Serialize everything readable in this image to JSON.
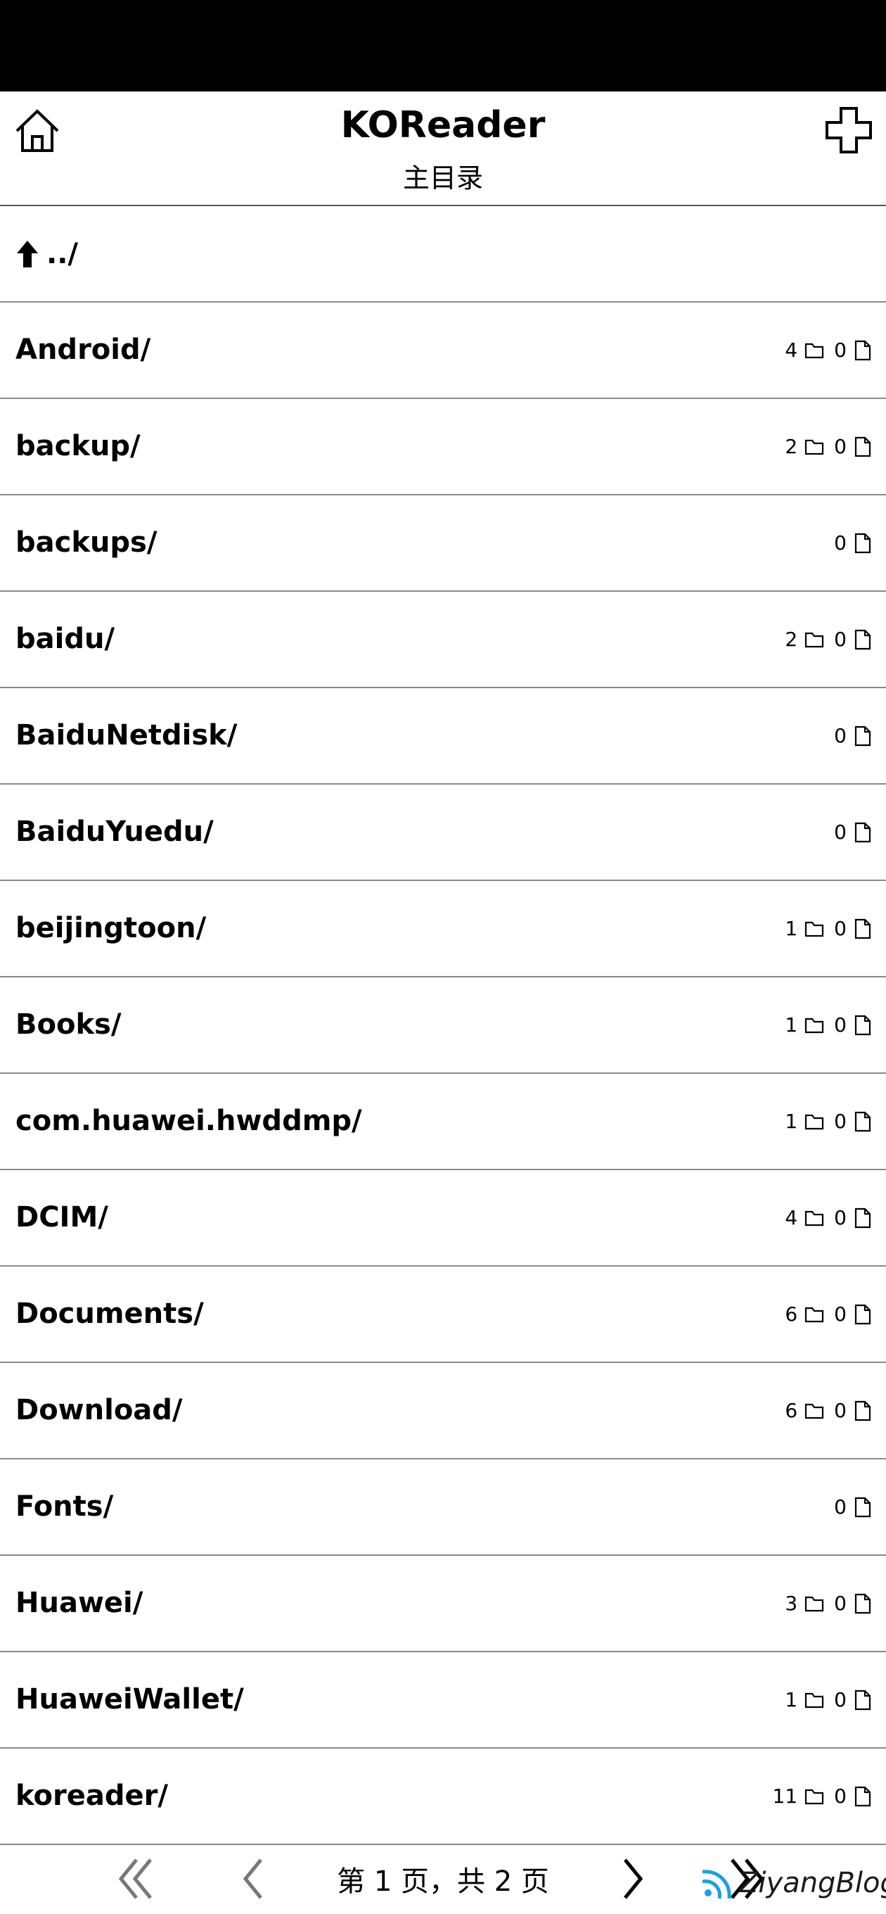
{
  "header": {
    "title": "KOReader",
    "subtitle": "主目录"
  },
  "up_item": {
    "label": "../"
  },
  "items": [
    {
      "name": "Android/",
      "folders": "4",
      "files": "0"
    },
    {
      "name": "backup/",
      "folders": "2",
      "files": "0"
    },
    {
      "name": "backups/",
      "folders": "",
      "files": "0"
    },
    {
      "name": "baidu/",
      "folders": "2",
      "files": "0"
    },
    {
      "name": "BaiduNetdisk/",
      "folders": "",
      "files": "0"
    },
    {
      "name": "BaiduYuedu/",
      "folders": "",
      "files": "0"
    },
    {
      "name": "beijingtoon/",
      "folders": "1",
      "files": "0"
    },
    {
      "name": "Books/",
      "folders": "1",
      "files": "0"
    },
    {
      "name": "com.huawei.hwddmp/",
      "folders": "1",
      "files": "0"
    },
    {
      "name": "DCIM/",
      "folders": "4",
      "files": "0"
    },
    {
      "name": "Documents/",
      "folders": "6",
      "files": "0"
    },
    {
      "name": "Download/",
      "folders": "6",
      "files": "0"
    },
    {
      "name": "Fonts/",
      "folders": "",
      "files": "0"
    },
    {
      "name": "Huawei/",
      "folders": "3",
      "files": "0"
    },
    {
      "name": "HuaweiWallet/",
      "folders": "1",
      "files": "0"
    },
    {
      "name": "koreader/",
      "folders": "11",
      "files": "0"
    }
  ],
  "footer": {
    "page_label": "第 1 页，共 2 页",
    "current_page": 1,
    "total_pages": 2
  },
  "watermark": {
    "text": "ZiyangBlog",
    "color": "#1aa0e0"
  },
  "icons": {
    "home": "home-icon",
    "add": "plus-icon",
    "up": "arrow-up-icon",
    "folder": "folder-icon",
    "file": "file-icon",
    "first": "double-chevron-left-icon",
    "prev": "chevron-left-icon",
    "next": "chevron-right-icon",
    "last": "double-chevron-right-icon"
  }
}
